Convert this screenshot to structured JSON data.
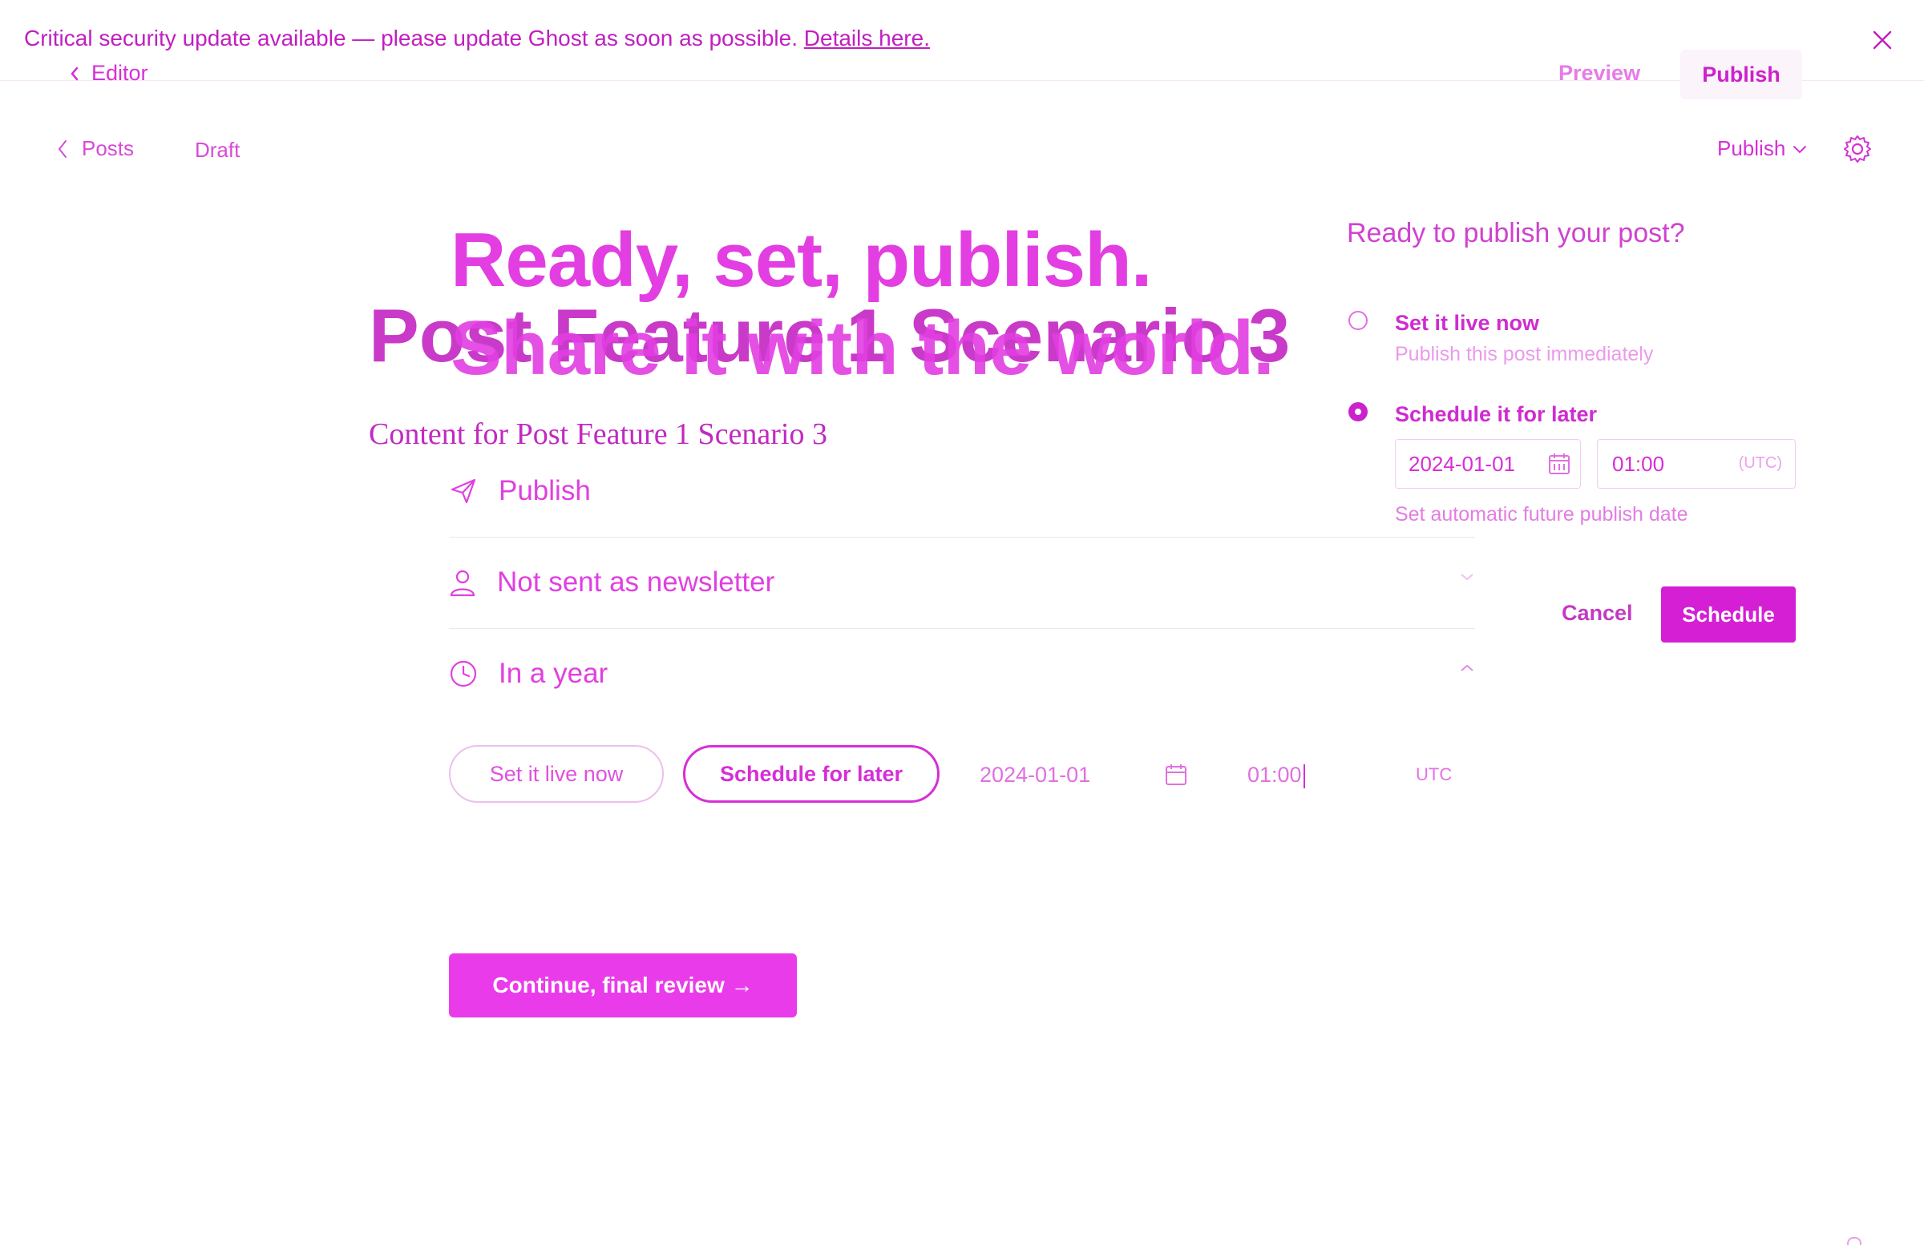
{
  "colors": {
    "accent": "#d62fd6",
    "accent_dark": "#c018c0",
    "accent_light": "#eb9aeb",
    "button_fill": "#ea3bea",
    "background": "#ffffff"
  },
  "banner": {
    "text": "Critical security update available — please update Ghost as soon as possible.",
    "link": "Details here.",
    "close_icon": "close-icon"
  },
  "topbar": {
    "back_label": "Editor",
    "preview_label": "Preview",
    "publish_label": "Publish"
  },
  "editor_header": {
    "posts_label": "Posts",
    "status": "Draft",
    "publish_dropdown": "Publish"
  },
  "flow": {
    "title_line1": "Ready, set, publish.",
    "title_line2": "Share it with the world."
  },
  "post": {
    "title": "Post Feature 1 Scenario 3",
    "content": "Content for Post Feature 1 Scenario 3"
  },
  "options": {
    "publish": {
      "label": "Publish",
      "icon": "send-icon"
    },
    "newsletter": {
      "label": "Not sent as newsletter",
      "icon": "user-icon"
    },
    "schedule": {
      "label": "In a year",
      "icon": "clock-icon"
    }
  },
  "schedule_inline": {
    "now_label": "Set it live now",
    "later_label": "Schedule for later",
    "date": "2024-01-01",
    "time": "01:00",
    "tz": "UTC"
  },
  "continue_label": "Continue, final review →",
  "popover": {
    "title": "Ready to publish your post?",
    "now_label": "Set it live now",
    "now_desc": "Publish this post immediately",
    "later_label": "Schedule it for later",
    "date": "2024-01-01",
    "time": "01:00",
    "tz": "(UTC)",
    "date_help": "Set automatic future publish date",
    "cancel_label": "Cancel",
    "schedule_label": "Schedule"
  }
}
